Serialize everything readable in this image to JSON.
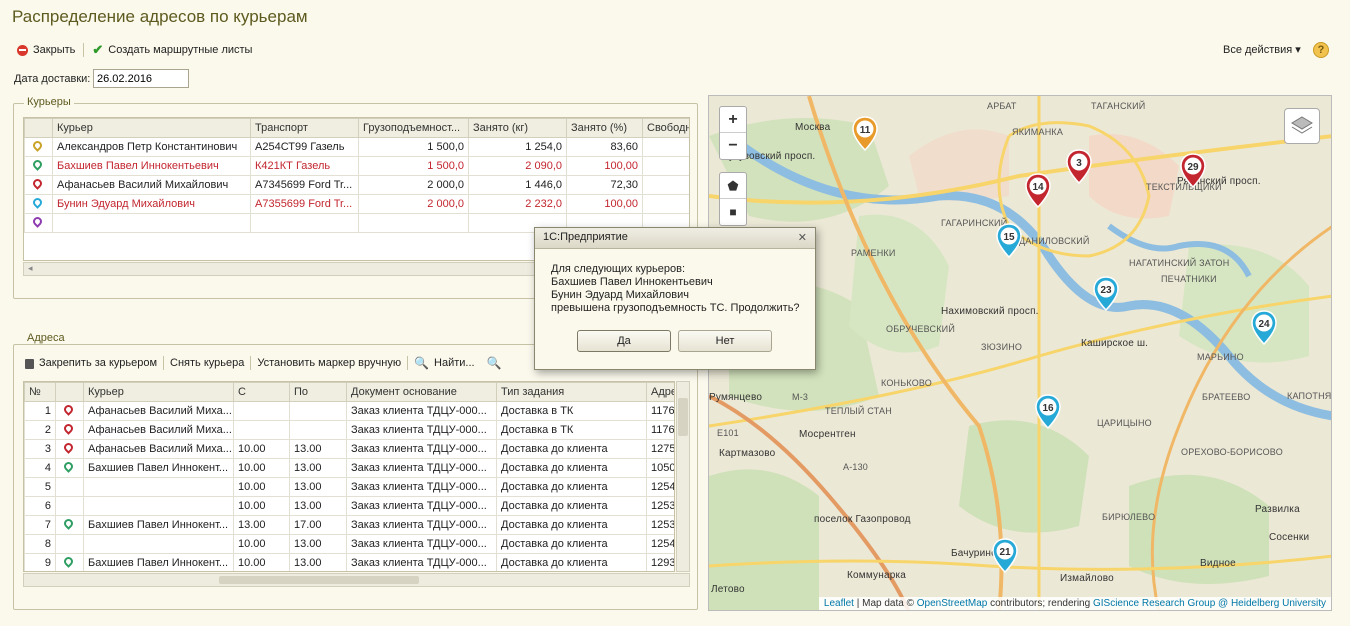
{
  "window": {
    "title": "Распределение адресов по курьерам"
  },
  "toolbar": {
    "close_label": "Закрыть",
    "create_label": "Создать маршрутные листы",
    "all_actions_label": "Все действия ▾",
    "help_label": "?"
  },
  "delivery": {
    "label": "Дата доставки:",
    "value": "26.02.2016"
  },
  "couriers": {
    "group_label": "Курьеры",
    "columns": [
      "Курьер",
      "Транспорт",
      "Грузоподъемност...",
      "Занято (кг)",
      "Занято (%)",
      "Свободн"
    ],
    "rows": [
      {
        "name": "Александров Петр Константинович",
        "transport": "А254СТ99 Газель",
        "capacity": "1 500,0",
        "used_kg": "1 254,0",
        "used_pct": "83,60",
        "free": "",
        "pin_color": "#c9a227",
        "over": false
      },
      {
        "name": "Бахшиев Павел Иннокентьевич",
        "transport": "К421КТ Газель",
        "capacity": "1 500,0",
        "used_kg": "2 090,0",
        "used_pct": "100,00",
        "free": "",
        "pin_color": "#2e9e62",
        "over": true
      },
      {
        "name": "Афанасьев Василий Михайлович",
        "transport": "А7345699 Ford Tr...",
        "capacity": "2 000,0",
        "used_kg": "1 446,0",
        "used_pct": "72,30",
        "free": "",
        "pin_color": "#c3262f",
        "over": false
      },
      {
        "name": "Бунин Эдуард Михайлович",
        "transport": "А7355699 Ford Tr...",
        "capacity": "2 000,0",
        "used_kg": "2 232,0",
        "used_pct": "100,00",
        "free": "",
        "pin_color": "#27a9d8",
        "over": true
      },
      {
        "name": "",
        "transport": "",
        "capacity": "",
        "used_kg": "",
        "used_pct": "",
        "free": "",
        "pin_color": "#8e3ab0",
        "over": false
      }
    ]
  },
  "addresses": {
    "group_label": "Адреса",
    "toolbar": {
      "pin_label": "Закрепить за курьером",
      "unpin_label": "Снять курьера",
      "marker_label": "Установить маркер вручную",
      "find_label": "Найти..."
    },
    "columns": [
      "№",
      "",
      "Курьер",
      "С",
      "По",
      "Документ основание",
      "Тип задания",
      "Адре"
    ],
    "rows": [
      {
        "n": "1",
        "pin_color": "#c3262f",
        "courier": "Афанасьев Василий Миха...",
        "from": "",
        "to": "",
        "doc": "Заказ клиента ТДЦУ-000...",
        "type": "Доставка в ТК",
        "addr": "1176"
      },
      {
        "n": "2",
        "pin_color": "#c3262f",
        "courier": "Афанасьев Василий Миха...",
        "from": "",
        "to": "",
        "doc": "Заказ клиента ТДЦУ-000...",
        "type": "Доставка в ТК",
        "addr": "1176"
      },
      {
        "n": "3",
        "pin_color": "#c3262f",
        "courier": "Афанасьев Василий Миха...",
        "from": "10.00",
        "to": "13.00",
        "doc": "Заказ клиента ТДЦУ-000...",
        "type": "Доставка до клиента",
        "addr": "1275"
      },
      {
        "n": "4",
        "pin_color": "#2e9e62",
        "courier": "Бахшиев Павел Иннокент...",
        "from": "10.00",
        "to": "13.00",
        "doc": "Заказ клиента ТДЦУ-000...",
        "type": "Доставка до клиента",
        "addr": "1050"
      },
      {
        "n": "5",
        "pin_color": "",
        "courier": "",
        "from": "10.00",
        "to": "13.00",
        "doc": "Заказ клиента ТДЦУ-000...",
        "type": "Доставка до клиента",
        "addr": "1254"
      },
      {
        "n": "6",
        "pin_color": "",
        "courier": "",
        "from": "10.00",
        "to": "13.00",
        "doc": "Заказ клиента ТДЦУ-000...",
        "type": "Доставка до клиента",
        "addr": "1253"
      },
      {
        "n": "7",
        "pin_color": "#2e9e62",
        "courier": "Бахшиев Павел Иннокент...",
        "from": "13.00",
        "to": "17.00",
        "doc": "Заказ клиента ТДЦУ-000...",
        "type": "Доставка до клиента",
        "addr": "1253"
      },
      {
        "n": "8",
        "pin_color": "",
        "courier": "",
        "from": "10.00",
        "to": "13.00",
        "doc": "Заказ клиента ТДЦУ-000...",
        "type": "Доставка до клиента",
        "addr": "1254"
      },
      {
        "n": "9",
        "pin_color": "#2e9e62",
        "courier": "Бахшиев Павел Иннокент...",
        "from": "10.00",
        "to": "13.00",
        "doc": "Заказ клиента ТДЦУ-000...",
        "type": "Доставка до клиента",
        "addr": "1293"
      }
    ]
  },
  "dialog": {
    "title": "1С:Предприятие",
    "close": "✕",
    "lines": [
      "Для следующих курьеров:",
      "Бахшиев Павел Иннокентьевич",
      "Бунин Эдуард Михайлович",
      "превышена грузоподъемность ТС. Продолжить?"
    ],
    "yes": "Да",
    "no": "Нет"
  },
  "map": {
    "zoom_in": "+",
    "zoom_out": "−",
    "markers": [
      {
        "label": "11",
        "color": "#e89a2a"
      },
      {
        "label": "3",
        "color": "#c3262f"
      },
      {
        "label": "14",
        "color": "#c3262f"
      },
      {
        "label": "29",
        "color": "#c3262f"
      },
      {
        "label": "15",
        "color": "#27a9d8"
      },
      {
        "label": "23",
        "color": "#27a9d8"
      },
      {
        "label": "24",
        "color": "#27a9d8"
      },
      {
        "label": "16",
        "color": "#27a9d8"
      },
      {
        "label": "21",
        "color": "#27a9d8"
      }
    ],
    "places": [
      "АРБАТ",
      "ТАГАНСКИЙ",
      "ЯКИМАНКА",
      "ТЕКСТИЛЬЩИКИ",
      "ГАГАРИНСКИЙ",
      "ДАНИЛОВСКИЙ",
      "НАГАТИНСКИЙ ЗАТОН",
      "ПЕЧАТНИКИ",
      "РАМЕНКИ",
      "ОБРУЧЕВСКИЙ",
      "КОНЬКОВО",
      "ЗЮЗИНО",
      "Румянцево",
      "Мосрентген",
      "Картмазово",
      "ТЕПЛЫЙ СТАН",
      "ЦАРИЦЫНО",
      "МАРЬИНО",
      "БРАТЕЕВО",
      "КАПОТНЯ",
      "ОРЕХОВО-БОРИСОВО",
      "Развилка",
      "Бачурино",
      "Коммунарка",
      "Измайлово",
      "Видное",
      "Летово",
      "БИРЮЛЕВО",
      "поселок Газопровод",
      "Сосенки",
      "Кутузовский просп.",
      "Рязанский просп.",
      "Нахимовский просп.",
      "Каширское ш.",
      "Москва",
      "М-3",
      "Е101",
      "А-130"
    ],
    "attribution": {
      "leaflet": "Leaflet",
      "text1": " | Map data © ",
      "osm": "OpenStreetMap",
      "text2": " contributors; rendering ",
      "gis": "GIScience Research Group @ Heidelberg University"
    }
  }
}
